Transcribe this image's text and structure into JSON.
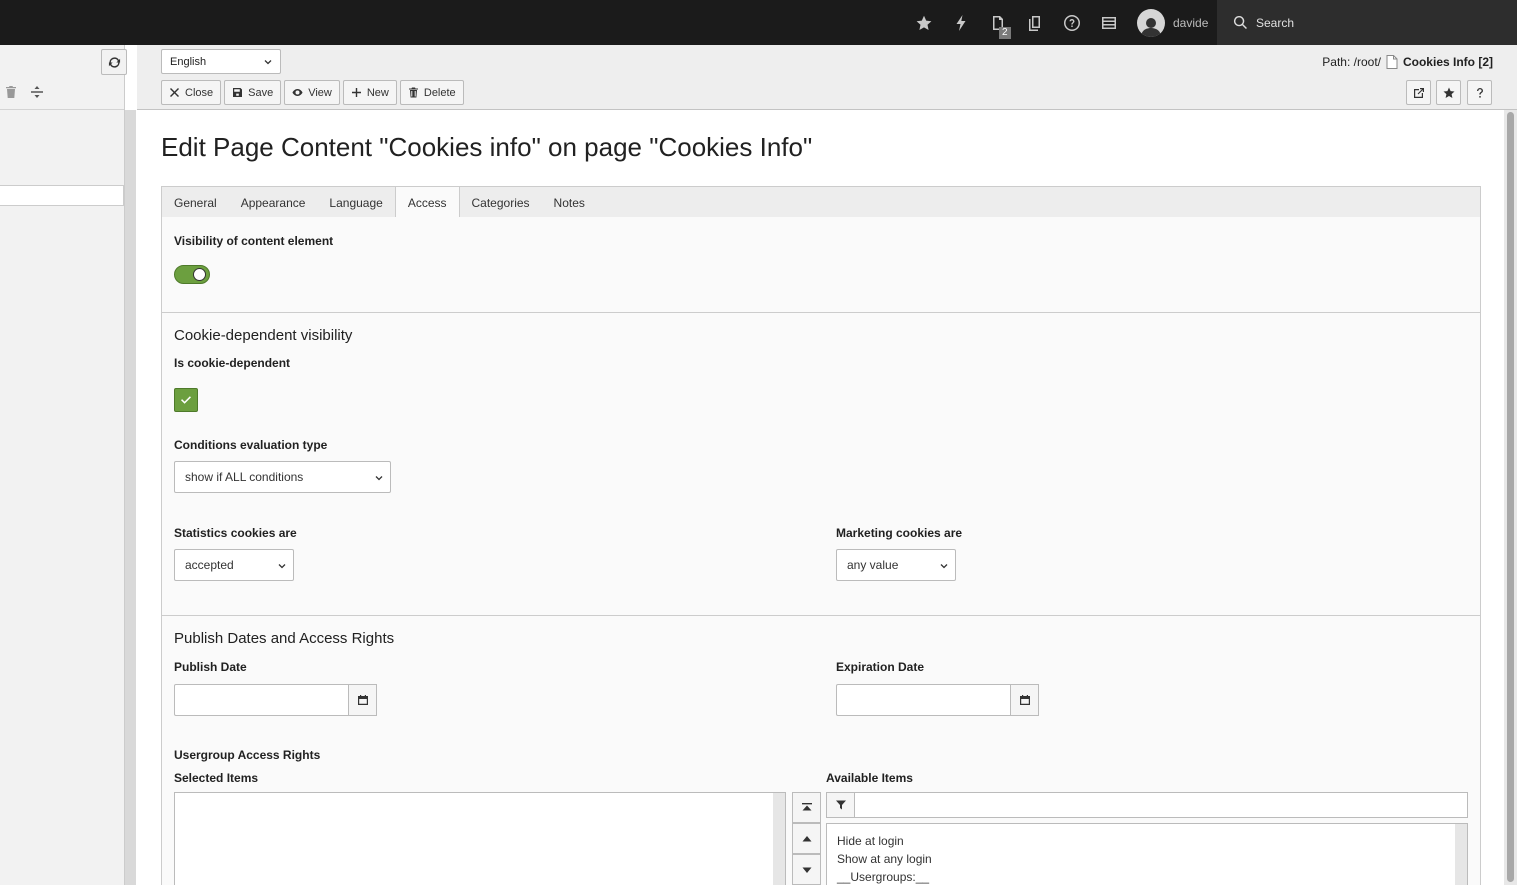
{
  "topbar": {
    "bookmark_badge": "2",
    "username": "davide",
    "search_placeholder": "Search"
  },
  "docheader": {
    "language": "English",
    "path_label": "Path: /root/",
    "path_page": "Cookies Info [2]",
    "buttons": {
      "close": "Close",
      "save": "Save",
      "view": "View",
      "new": "New",
      "delete": "Delete"
    }
  },
  "page": {
    "title": "Edit Page Content \"Cookies info\" on page \"Cookies Info\"",
    "tabs": [
      "General",
      "Appearance",
      "Language",
      "Access",
      "Categories",
      "Notes"
    ],
    "active_tab": "Access"
  },
  "access": {
    "visibility_label": "Visibility of content element",
    "visibility_on": true,
    "cookie_section_title": "Cookie-dependent visibility",
    "cookie_dependent_label": "Is cookie-dependent",
    "cookie_dependent_checked": true,
    "conditions_label": "Conditions evaluation type",
    "conditions_value": "show if ALL conditions",
    "statistics_label": "Statistics cookies are",
    "statistics_value": "accepted",
    "marketing_label": "Marketing cookies are",
    "marketing_value": "any value",
    "publish_section_title": "Publish Dates and Access Rights",
    "publish_date_label": "Publish Date",
    "expiration_date_label": "Expiration Date",
    "usergroup_label": "Usergroup Access Rights",
    "selected_items_label": "Selected Items",
    "available_items_label": "Available Items",
    "available_items": [
      "Hide at login",
      "Show at any login",
      "__Usergroups:__"
    ]
  },
  "colors": {
    "topbar_bg": "#1b1b1b",
    "accent_green": "#6c9f3f"
  }
}
